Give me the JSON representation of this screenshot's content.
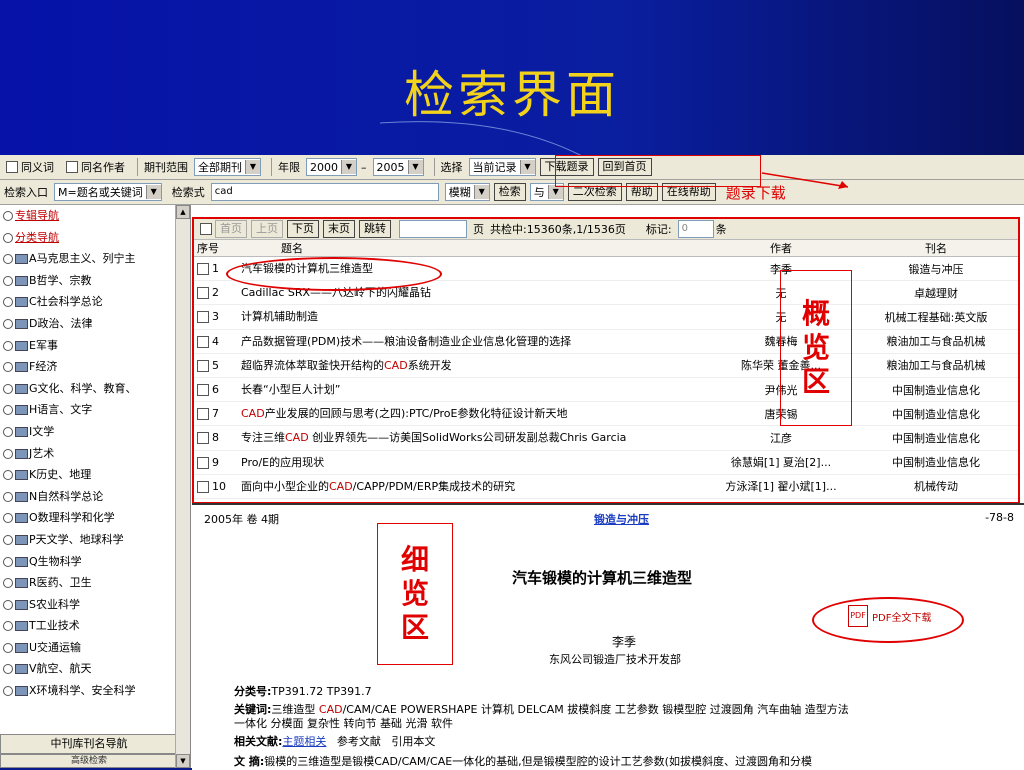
{
  "slide": {
    "title": "检索界面"
  },
  "toolbar1": {
    "synonym": "同义词",
    "same_author": "同名作者",
    "period_label": "期刊范围",
    "period_value": "全部期刊",
    "year_label": "年限",
    "year_from": "2000",
    "dash": "–",
    "year_to": "2005",
    "select_label": "选择",
    "select_value": "当前记录",
    "download_btn": "下载题录",
    "home_btn": "回到首页"
  },
  "toolbar2": {
    "entry_label": "检索入口",
    "entry_value": "M=题名或关键词",
    "query_label": "检索式",
    "query_value": "cad",
    "mode_value": "模糊",
    "search_btn": "检索",
    "logic_value": "与",
    "second_btn": "二次检索",
    "help_btn": "帮助",
    "online_help_btn": "在线帮助",
    "annotation": "题录下载"
  },
  "sidebar": {
    "items": [
      {
        "label": "专辑导航",
        "type": "link"
      },
      {
        "label": "分类导航",
        "type": "link"
      },
      {
        "label": "A马克思主义、列宁主",
        "type": "folder"
      },
      {
        "label": "B哲学、宗教",
        "type": "folder"
      },
      {
        "label": "C社会科学总论",
        "type": "folder"
      },
      {
        "label": "D政治、法律",
        "type": "folder"
      },
      {
        "label": "E军事",
        "type": "folder"
      },
      {
        "label": "F经济",
        "type": "folder"
      },
      {
        "label": "G文化、科学、教育、",
        "type": "folder"
      },
      {
        "label": "H语言、文字",
        "type": "folder"
      },
      {
        "label": "I文学",
        "type": "folder"
      },
      {
        "label": "J艺术",
        "type": "folder"
      },
      {
        "label": "K历史、地理",
        "type": "folder"
      },
      {
        "label": "N自然科学总论",
        "type": "folder"
      },
      {
        "label": "O数理科学和化学",
        "type": "folder"
      },
      {
        "label": "P天文学、地球科学",
        "type": "folder"
      },
      {
        "label": "Q生物科学",
        "type": "folder"
      },
      {
        "label": "R医药、卫生",
        "type": "folder"
      },
      {
        "label": "S农业科学",
        "type": "folder"
      },
      {
        "label": "T工业技术",
        "type": "folder"
      },
      {
        "label": "U交通运输",
        "type": "folder"
      },
      {
        "label": "V航空、航天",
        "type": "folder"
      },
      {
        "label": "X环境科学、安全科学",
        "type": "folder"
      }
    ],
    "nav_button": "中刊库刊名导航",
    "nav_button2": "高级检索"
  },
  "results": {
    "pager": {
      "first": "首页",
      "prev": "上页",
      "next": "下页",
      "last": "末页",
      "jump": "跳转",
      "page_unit": "页",
      "summary": "共检中:15360条,1/1536页",
      "mark_label": "标记:",
      "mark_value": "0",
      "mark_unit": "条"
    },
    "headers": {
      "no": "序号",
      "title": "题名",
      "author": "作者",
      "journal": "刊名"
    },
    "rows": [
      {
        "no": "1",
        "title": "汽车锻模的计算机三维造型",
        "author": "李季",
        "journal": "锻造与冲压"
      },
      {
        "no": "2",
        "title": "Cadillac SRX——八达岭下的闪耀晶钻",
        "author": "无",
        "journal": "卓越理财"
      },
      {
        "no": "3",
        "title": "计算机辅助制造",
        "author": "无",
        "journal": "机械工程基础:英文版"
      },
      {
        "no": "4",
        "title": "产品数据管理(PDM)技术——粮油设备制造业企业信息化管理的选择",
        "author": "魏春梅",
        "journal": "粮油加工与食品机械"
      },
      {
        "no": "5",
        "title_pre": "超临界流体萃取釜快开结构的",
        "title_hl": "CAD",
        "title_post": "系统开发",
        "author": "陈华荣 董金善...",
        "journal": "粮油加工与食品机械"
      },
      {
        "no": "6",
        "title": "长春“小型巨人计划”",
        "author": "尹伟光",
        "journal": "中国制造业信息化"
      },
      {
        "no": "7",
        "title_hl": "CAD",
        "title_post": "产业发展的回顾与思考(之四):PTC/ProE参数化特征设计新天地",
        "author": "唐荣锡",
        "journal": "中国制造业信息化"
      },
      {
        "no": "8",
        "title_pre": "专注三维",
        "title_hl": "CAD",
        "title_post": " 创业界领先——访美国SolidWorks公司研发副总裁Chris Garcia",
        "author": "江彦",
        "journal": "中国制造业信息化"
      },
      {
        "no": "9",
        "title": "Pro/E的应用现状",
        "author": "徐慧娟[1] 夏治[2]...",
        "journal": "中国制造业信息化"
      },
      {
        "no": "10",
        "title_pre": "面向中小型企业的",
        "title_hl": "CAD",
        "title_post": "/CAPP/PDM/ERP集成技术的研究",
        "author": "方泳泽[1] 翟小斌[1]...",
        "journal": "机械传动"
      }
    ],
    "annotation": [
      "概",
      "览",
      "区"
    ]
  },
  "detail": {
    "date": "2005年 卷 4期",
    "journal": "锻造与冲压",
    "page": "-78-8",
    "title": "汽车锻模的计算机三维造型",
    "author": "李季",
    "org": "东风公司锻造厂技术开发部",
    "pdf_label": "PDF全文下载",
    "pdf_icon_text": "PDF",
    "class_label": "分类号:",
    "class_value": "TP391.72 TP391.7",
    "kw_label": "关键词:",
    "kw_pre": "三维造型 ",
    "kw_hl": "CAD",
    "kw_post": "/CAM/CAE POWERSHAPE 计算机 DELCAM 拔模斜度 工艺参数 锻模型腔 过渡圆角 汽车曲轴 造型方法",
    "kw_line2": "一体化 分模面 复杂性 转向节 基础 光滑 软件",
    "rel_label": "相关文献:",
    "rel_link": "主题相关",
    "rel_ref": "参考文献",
    "rel_cite": "引用本文",
    "abs_label": "文 摘:",
    "abs_text": "锻模的三维造型是锻模CAD/CAM/CAE一体化的基础,但是锻模型腔的设计工艺参数(如拔模斜度、过渡圆角和分模",
    "annotation": [
      "细",
      "览",
      "区"
    ]
  },
  "colors": {
    "accent_red": "#e00000",
    "title_yellow": "#f2d21a",
    "slide_blue": "#0a1ea0",
    "link_blue": "#1a3cc0"
  }
}
